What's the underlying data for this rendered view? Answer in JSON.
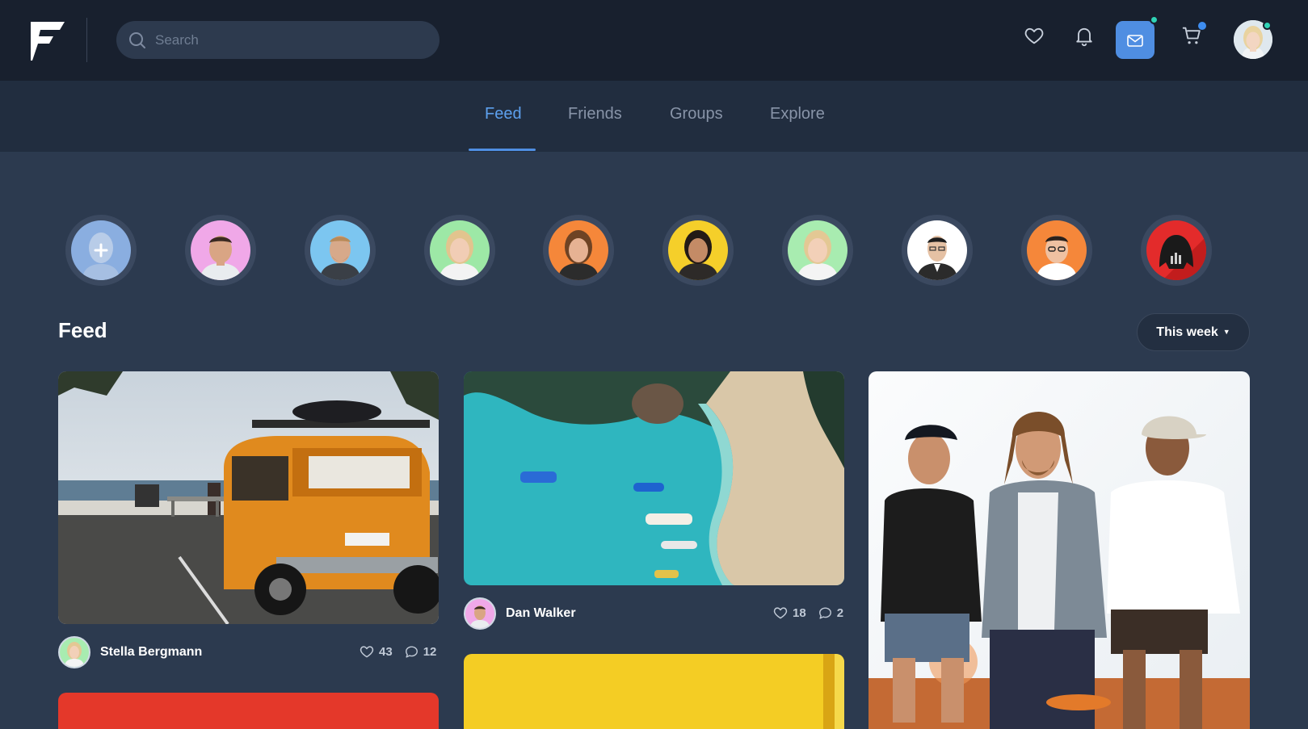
{
  "topbar": {
    "logo": "F",
    "search": {
      "placeholder": "Search",
      "value": ""
    },
    "icons": [
      "heart-icon",
      "bell-icon",
      "mail-icon",
      "cart-icon"
    ],
    "accent_color": "#4f8ee2",
    "badge_colors": {
      "mail": "#2fd3b6",
      "cart": "#3e8df0",
      "avatar": "#2fd3b6"
    }
  },
  "tabs": [
    {
      "label": "Feed",
      "active": true
    },
    {
      "label": "Friends",
      "active": false
    },
    {
      "label": "Groups",
      "active": false
    },
    {
      "label": "Explore",
      "active": false
    }
  ],
  "stories": [
    {
      "kind": "add",
      "icon": "plus-icon",
      "bg": "#8aaee0"
    },
    {
      "kind": "user",
      "bg": "#f0a8e8"
    },
    {
      "kind": "user",
      "bg": "#7cc6f0"
    },
    {
      "kind": "user",
      "bg": "#9de8a6"
    },
    {
      "kind": "user",
      "bg": "#f5873a"
    },
    {
      "kind": "user",
      "bg": "#f5cf2a"
    },
    {
      "kind": "user",
      "bg": "#a8ecb0"
    },
    {
      "kind": "user",
      "bg": "#ffffff"
    },
    {
      "kind": "user",
      "bg": "#f5873a"
    },
    {
      "kind": "user",
      "bg": "#e32b2b"
    }
  ],
  "feed": {
    "title": "Feed",
    "filter": {
      "selected": "This week"
    },
    "posts": [
      {
        "author": "Stella Bergmann",
        "likes": "43",
        "comments": "12"
      },
      {
        "author": "Dan Walker",
        "likes": "18",
        "comments": "2"
      }
    ]
  }
}
